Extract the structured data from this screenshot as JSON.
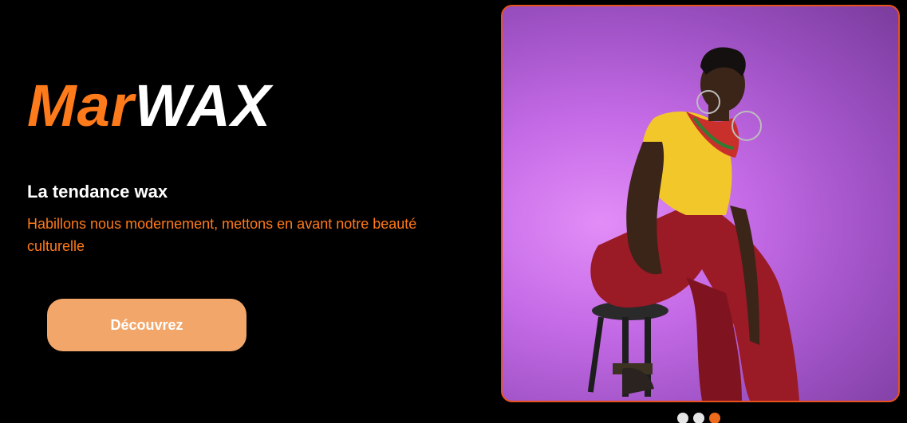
{
  "brand": {
    "part1": "Mar",
    "part2": "WAX"
  },
  "hero": {
    "tagline": "La tendance wax",
    "subtitle": "Habillons nous modernement, mettons en avant notre beauté culturelle",
    "cta_label": "Découvrez"
  },
  "carousel": {
    "slide_count": 3,
    "active_index": 2,
    "image_subject": "woman-seated-on-stool-photo"
  },
  "colors": {
    "accent": "#ff7a1a",
    "frame_border": "#e8521c",
    "button_bg": "#f2a66a",
    "dot_inactive": "#e6e6e6",
    "dot_active": "#ee6a1c",
    "background": "#000000"
  }
}
